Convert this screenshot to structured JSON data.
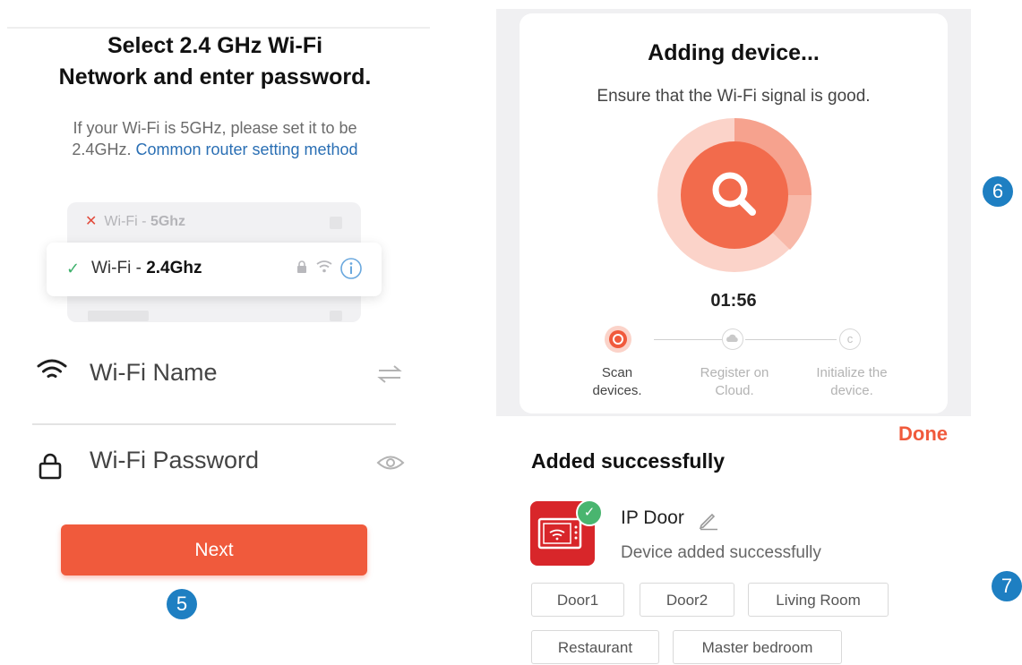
{
  "wifi_setup": {
    "title_line1": "Select 2.4 GHz Wi-Fi",
    "title_line2": "Network and enter password.",
    "hint_line1": "If your Wi-Fi is 5GHz, please set it to be",
    "hint_line2_prefix": "2.4GHz. ",
    "hint_link": "Common router setting method",
    "network_5g_prefix": "Wi-Fi - ",
    "network_5g_band": "5Ghz",
    "network_24_prefix": "Wi-Fi - ",
    "network_24_band": "2.4Ghz",
    "wifi_name_placeholder": "Wi-Fi Name",
    "wifi_password_placeholder": "Wi-Fi Password",
    "next_label": "Next",
    "step_number": "5"
  },
  "adding": {
    "title": "Adding device...",
    "subtitle": "Ensure that the Wi-Fi signal is good.",
    "countdown": "01:56",
    "steps": [
      {
        "line1": "Scan",
        "line2": "devices."
      },
      {
        "line1": "Register on",
        "line2": "Cloud."
      },
      {
        "line1": "Initialize the",
        "line2": "device."
      }
    ],
    "step_number": "6"
  },
  "added": {
    "done_label": "Done",
    "title": "Added successfully",
    "device_name": "IP Door",
    "device_status": "Device added successfully",
    "rooms": [
      "Door1",
      "Door2",
      "Living Room",
      "Restaurant",
      "Master bedroom"
    ],
    "step_number": "7"
  },
  "colors": {
    "accent": "#f05a3c",
    "link": "#2a6fb4",
    "badge": "#1e7fc2",
    "success": "#49b56f",
    "device_tile": "#d8262a"
  },
  "icons": {
    "wifi_field": "wifi-icon",
    "password_field": "lock-icon",
    "switch": "swap-arrows-icon",
    "reveal": "eye-icon",
    "search": "search-icon",
    "edit": "pencil-icon"
  }
}
